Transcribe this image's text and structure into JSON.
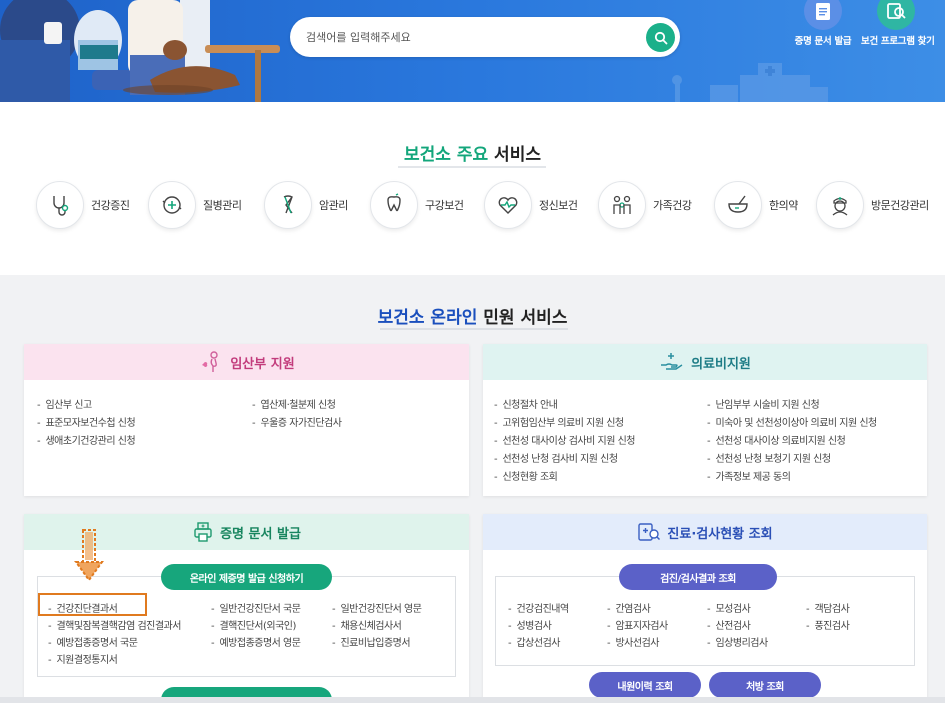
{
  "header": {
    "search_placeholder": "검색어를 입력해주세요",
    "quick_links": [
      {
        "label": "증명 문서 발급",
        "icon": "document-icon"
      },
      {
        "label": "보건 프로그램 찾기",
        "icon": "program-search-icon"
      }
    ]
  },
  "main_services": {
    "title_highlight": "보건소 주요",
    "title_rest": " 서비스",
    "items": [
      {
        "label": "건강증진",
        "icon": "stethoscope-icon"
      },
      {
        "label": "질병관리",
        "icon": "disease-plus-icon"
      },
      {
        "label": "암관리",
        "icon": "ribbon-icon"
      },
      {
        "label": "구강보건",
        "icon": "tooth-icon"
      },
      {
        "label": "정신보건",
        "icon": "heart-pulse-icon"
      },
      {
        "label": "가족건강",
        "icon": "family-icon"
      },
      {
        "label": "한의약",
        "icon": "mortar-icon"
      },
      {
        "label": "방문건강관리",
        "icon": "nurse-icon"
      }
    ]
  },
  "online_services": {
    "title_highlight": "보건소 온라인",
    "title_rest": " 민원 서비스",
    "pregnancy": {
      "title": "임산부 지원",
      "col1": [
        "임산부 신고",
        "표준모자보건수첩 신청",
        "생애초기건강관리 신청"
      ],
      "col2": [
        "엽산제·철분제 신청",
        "우울증 자가진단검사"
      ]
    },
    "medical_cost": {
      "title": "의료비지원",
      "col1": [
        "신청절차 안내",
        "고위험임산부 의료비 지원 신청",
        "선천성 대사이상 검사비 지원 신청",
        "선천성 난청 검사비 지원 신청",
        "신청현황 조회"
      ],
      "col2": [
        "난임부부 시술비 지원 신청",
        "미숙아 및 선천성이상아 의료비 지원 신청",
        "선천성 대사이상 의료비지원 신청",
        "선천성 난청 보청기 지원 신청",
        "가족정보 제공 동의"
      ]
    },
    "certificate": {
      "title": "증명 문서 발급",
      "button": "온라인 제증명 발급 신청하기",
      "col1": [
        "건강진단결과서",
        "결핵및잠복결핵감염 검진결과서",
        "예방접종증명서 국문",
        "지원결정통지서"
      ],
      "col2": [
        "일반건강진단서 국문",
        "결핵진단서(외국인)",
        "예방접종증명서 영문"
      ],
      "col3": [
        "일반건강진단서 영문",
        "채용신체검사서",
        "진료비납입증명서"
      ]
    },
    "exam": {
      "title": "진료·검사현황 조회",
      "button": "검진/검사결과 조회",
      "col1": [
        "건강검진내역",
        "성병검사",
        "갑상선검사"
      ],
      "col2": [
        "간염검사",
        "암표지자검사",
        "방사선검사"
      ],
      "col3": [
        "모성검사",
        "산전검사",
        "임상병리검사"
      ],
      "col4": [
        "객담검사",
        "풍진검사"
      ],
      "btn_history": "내원이력 조회",
      "btn_prescription": "처방 조회"
    }
  },
  "colors": {
    "banner": "#2a78dd",
    "green": "#13a67b",
    "navy": "#1a4fbd",
    "pink_head": "#fbe3ef",
    "mint_head": "#dff3f1",
    "blue_head": "#e3ecfb",
    "purple_btn": "#5b61c8",
    "highlight_orange": "#e07a1f"
  }
}
